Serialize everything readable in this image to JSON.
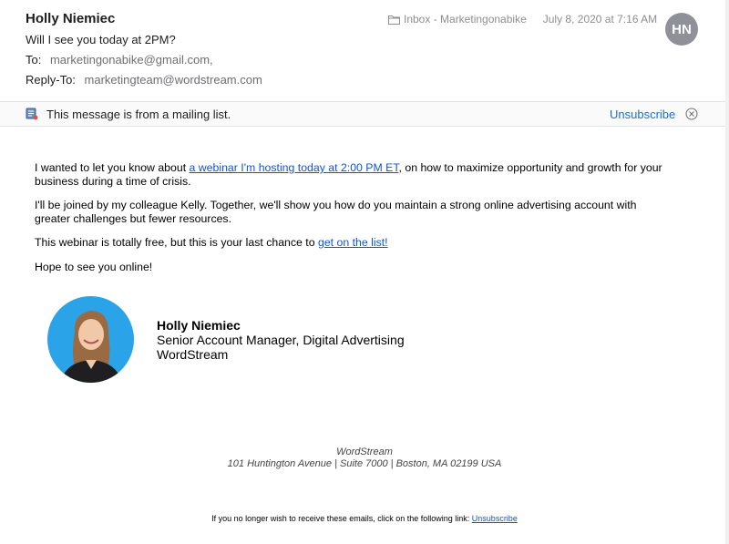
{
  "header": {
    "sender": "Holly Niemiec",
    "subject": "Will I see you today at 2PM?",
    "to_label": "To:",
    "to_value": "marketingonabike@gmail.com,",
    "replyto_label": "Reply-To:",
    "replyto_value": "marketingteam@wordstream.com",
    "mailbox": "Inbox - Marketingonabike",
    "date": "July 8, 2020 at 7:16 AM",
    "avatar_initials": "HN"
  },
  "banner": {
    "icon": "mailing-list-icon",
    "message": "This message is from a mailing list.",
    "unsubscribe_label": "Unsubscribe",
    "close_icon": "close-circle-icon"
  },
  "body": {
    "p1_before": "I wanted to let you know about ",
    "p1_link": "a webinar I'm hosting today at 2:00 PM ET",
    "p1_after": ", on how to maximize opportunity and growth for your business during a time of crisis.",
    "p2": "I'll be joined by my colleague Kelly. Together, we'll show you how do you maintain a strong online advertising account with greater challenges but fewer resources.",
    "p3_before": "This webinar is totally free, but this is your last chance to ",
    "p3_link": "get on the list!",
    "p4": "Hope to see you online!"
  },
  "signature": {
    "name": "Holly Niemiec",
    "title": "Senior Account Manager, Digital Advertising",
    "company": "WordStream"
  },
  "footer": {
    "company": "WordStream",
    "address": "101 Huntington Avenue | Suite 7000 | Boston, MA 02199 USA",
    "unsubscribe_text": "If you no longer wish to receive these emails, click on the following link: ",
    "unsubscribe_link": "Unsubscribe"
  },
  "colors": {
    "link": "#1155cc",
    "banner_link": "#1a6ed8",
    "avatar_bg": "#8e9298",
    "photo_bg": "#2aa3e8"
  }
}
